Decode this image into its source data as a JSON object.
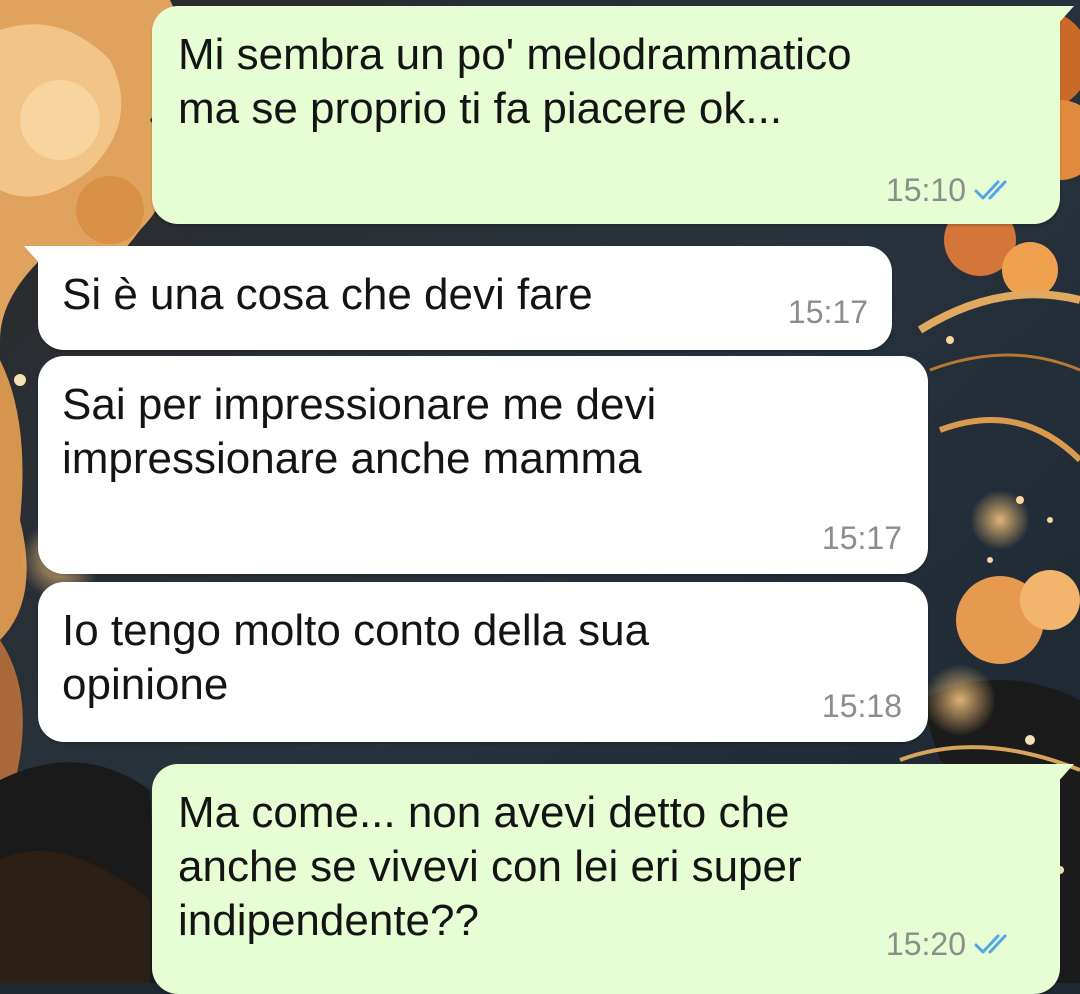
{
  "chat": {
    "messages": [
      {
        "direction": "outgoing",
        "text": "Mi sembra un po' melodrammatico\nma se proprio ti fa piacere ok...",
        "time": "15:10",
        "status": "read"
      },
      {
        "direction": "incoming",
        "text": "Si è una cosa che devi fare",
        "time": "15:17"
      },
      {
        "direction": "incoming",
        "text": "Sai per impressionare me devi\nimpressionare anche mamma",
        "time": "15:17"
      },
      {
        "direction": "incoming",
        "text": "Io tengo molto conto della sua\nopinione",
        "time": "15:18"
      },
      {
        "direction": "outgoing",
        "text": "Ma come... non avevi detto che\nanche se vivevi con lei eri super\nindipendente??",
        "time": "15:20",
        "status": "read"
      }
    ]
  },
  "icons": {
    "read_receipt": "double-check-icon"
  },
  "colors": {
    "outgoing_bubble": "#e7fdd3",
    "incoming_bubble": "#ffffff",
    "read_tick": "#53a6e6",
    "timestamp": "#8a8f8a"
  }
}
